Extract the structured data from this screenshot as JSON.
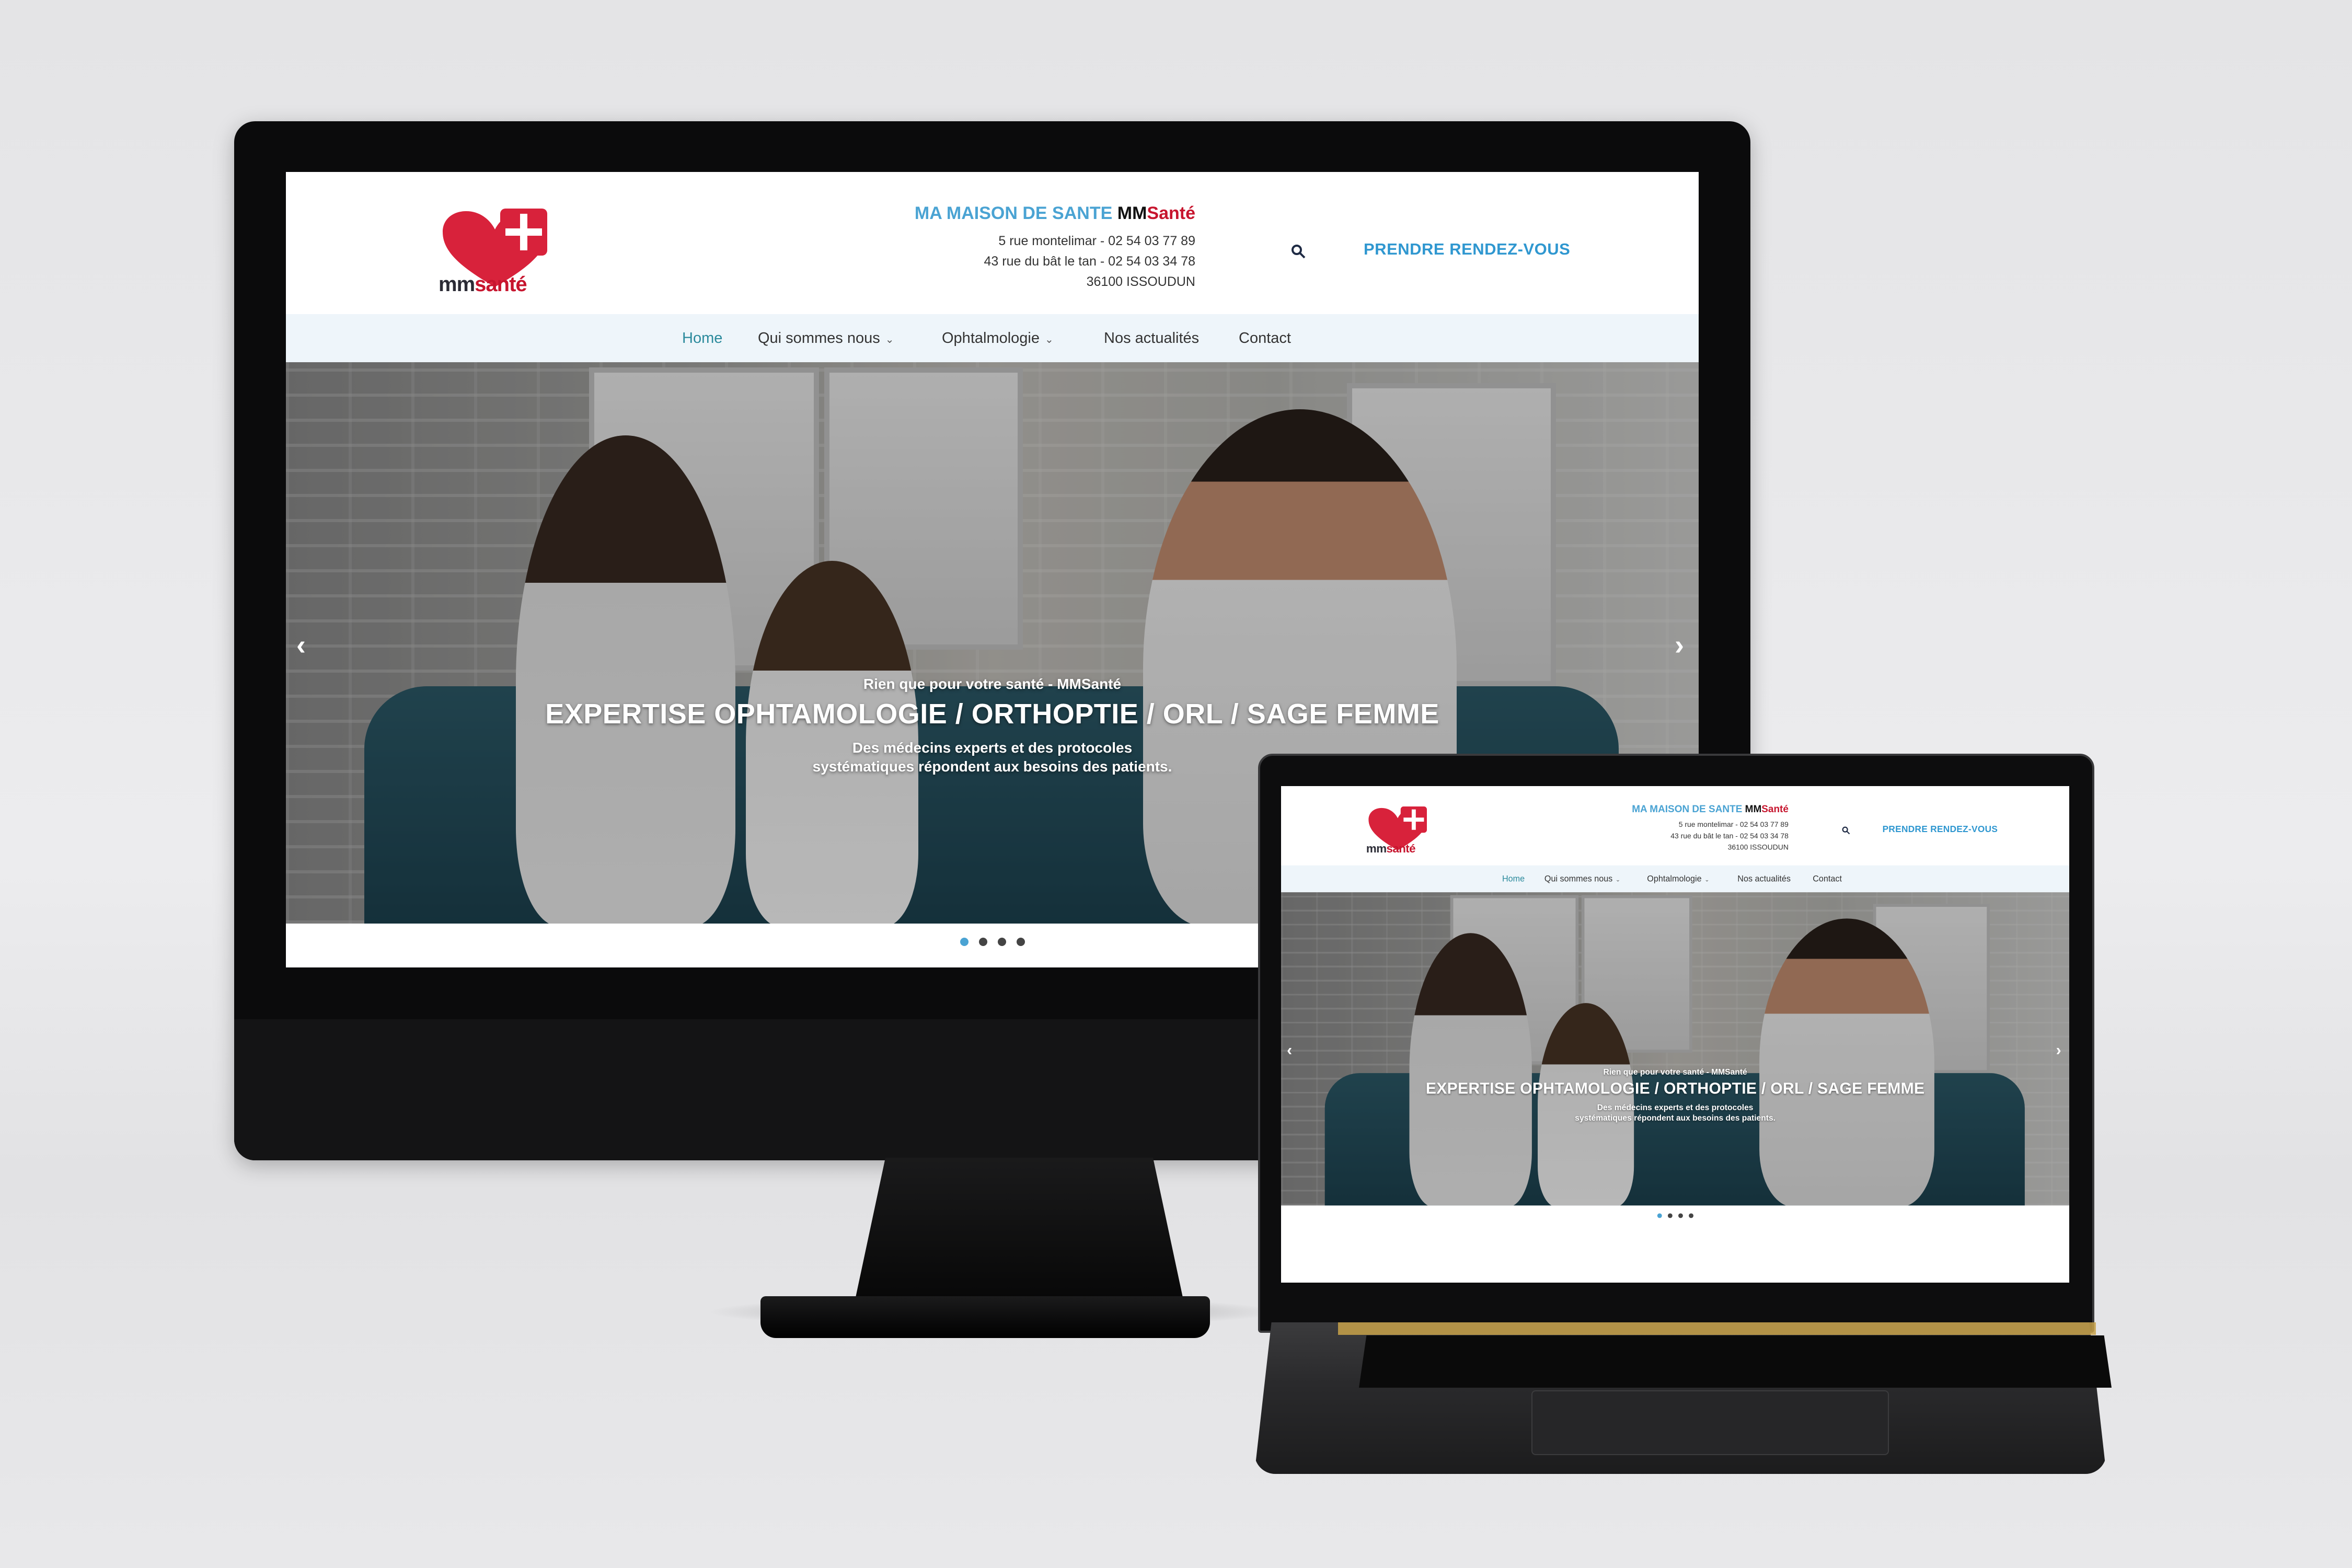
{
  "site": {
    "logo": {
      "prefix": "mm",
      "accent": "santé",
      "colors": {
        "heart": "#d8223b",
        "cross": "#ffffff"
      }
    },
    "brand": {
      "title": "MA MAISON DE SANTE",
      "mm": "MM",
      "sante": "Santé"
    },
    "address": {
      "line1": "5 rue montelimar - 02 54 03 77 89",
      "line2": "43 rue du bât le tan - 02 54 03 34 78",
      "line3": "36100 ISSOUDUN"
    },
    "search_icon": "search-icon",
    "cta": "PRENDRE RENDEZ-VOUS",
    "nav": {
      "home": "Home",
      "about": "Qui sommes nous",
      "ophtalmo": "Ophtalmologie",
      "news": "Nos actualités",
      "contact": "Contact"
    },
    "hero": {
      "subtitle": "Rien que pour votre santé - MMSanté",
      "title": "EXPERTISE OPHTAMOLOGIE / ORTHOPTIE / ORL / SAGE FEMME",
      "description": "Des médecins experts et des protocoles systématiques répondent aux besoins des patients.",
      "prev_arrow": "‹",
      "next_arrow": "›"
    },
    "slider": {
      "count": 4,
      "active": 1
    },
    "colors": {
      "accent": "#4aa3d3",
      "brand_red": "#c7152e",
      "nav_bg": "#eef5fa"
    }
  }
}
